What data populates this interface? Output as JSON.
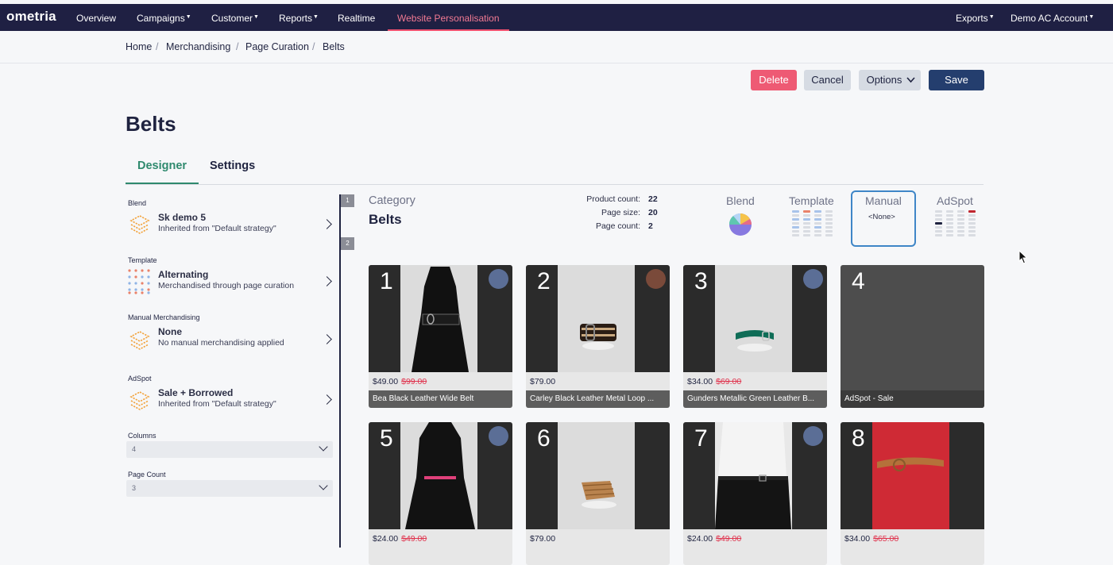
{
  "nav": {
    "logo": "ometria",
    "items": [
      "Overview",
      "Campaigns",
      "Customer",
      "Reports",
      "Realtime",
      "Website Personalisation"
    ],
    "right": [
      "Exports",
      "Demo AC Account"
    ],
    "caret": "▼"
  },
  "breadcrumb": [
    "Home",
    "Merchandising",
    "Page Curation",
    "Belts"
  ],
  "breadcrumb_sep": "/",
  "actions": {
    "delete": "Delete",
    "cancel": "Cancel",
    "options": "Options",
    "save": "Save"
  },
  "page_title": "Belts",
  "tabs": [
    "Designer",
    "Settings"
  ],
  "sidebar": {
    "sections": [
      {
        "label": "Blend",
        "title": "Sk demo 5",
        "sub": "Inherited from \"Default strategy\"",
        "icon": "layers-icon"
      },
      {
        "label": "Template",
        "title": "Alternating",
        "sub": "Merchandised through page curation",
        "icon": "grid-dots-icon"
      },
      {
        "label": "Manual Merchandising",
        "title": "None",
        "sub": "No manual merchandising applied",
        "icon": "layers-icon"
      },
      {
        "label": "AdSpot",
        "title": "Sale + Borrowed",
        "sub": "Inherited from \"Default strategy\"",
        "icon": "layers-icon"
      }
    ],
    "columns": {
      "label": "Columns",
      "value": "4"
    },
    "page_count": {
      "label": "Page Count",
      "value": "3"
    }
  },
  "page_tags": [
    "1",
    "2"
  ],
  "category": {
    "label": "Category",
    "name": "Belts"
  },
  "stats": [
    {
      "k": "Product count:",
      "v": "22"
    },
    {
      "k": "Page size:",
      "v": "20"
    },
    {
      "k": "Page count:",
      "v": "2"
    }
  ],
  "layers": {
    "blend": "Blend",
    "template": "Template",
    "manual": "Manual",
    "manual_value": "<None>",
    "adspot": "AdSpot"
  },
  "colors": {
    "nav": "#1f2043",
    "accent": "#f0506e",
    "delete": "#ee5a74",
    "save": "#243e6e",
    "designer": "#2f8a6e",
    "manual_border": "#3f86c7"
  },
  "products": [
    {
      "num": "1",
      "price": "$49.00",
      "old": "$99.00",
      "name": "Bea Black Leather Wide Belt"
    },
    {
      "num": "2",
      "price": "$79.00",
      "old": "",
      "name": "Carley Black Leather Metal Loop ..."
    },
    {
      "num": "3",
      "price": "$34.00",
      "old": "$69.00",
      "name": "Gunders Metallic Green Leather B..."
    },
    {
      "num": "4",
      "price": "",
      "old": "",
      "name": "AdSpot - Sale"
    },
    {
      "num": "5",
      "price": "$24.00",
      "old": "$49.00",
      "name": ""
    },
    {
      "num": "6",
      "price": "$79.00",
      "old": "",
      "name": ""
    },
    {
      "num": "7",
      "price": "$24.00",
      "old": "$49.00",
      "name": ""
    },
    {
      "num": "8",
      "price": "$34.00",
      "old": "$65.00",
      "name": ""
    }
  ]
}
